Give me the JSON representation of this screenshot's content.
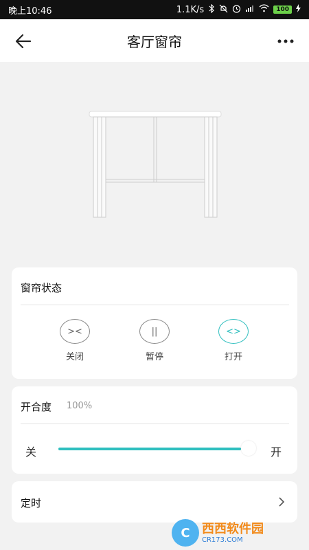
{
  "status_bar": {
    "time": "晚上10:46",
    "network_speed": "1.1K/s",
    "battery": "100"
  },
  "header": {
    "title": "客厅窗帘"
  },
  "curtain_state": {
    "title": "窗帘状态",
    "buttons": [
      {
        "label": "关闭",
        "glyph": "><"
      },
      {
        "label": "暂停",
        "glyph": "||"
      },
      {
        "label": "打开",
        "glyph": "<>"
      }
    ],
    "active": "打开"
  },
  "opening": {
    "title": "开合度",
    "percent_text": "100%",
    "value": 100,
    "min_label": "关",
    "max_label": "开"
  },
  "timer": {
    "title": "定时"
  },
  "watermark": {
    "logo": "C",
    "brand": "西西软件园",
    "site": "CR173.COM"
  },
  "colors": {
    "accent": "#2fbfbf",
    "background": "#f2f2f2"
  }
}
